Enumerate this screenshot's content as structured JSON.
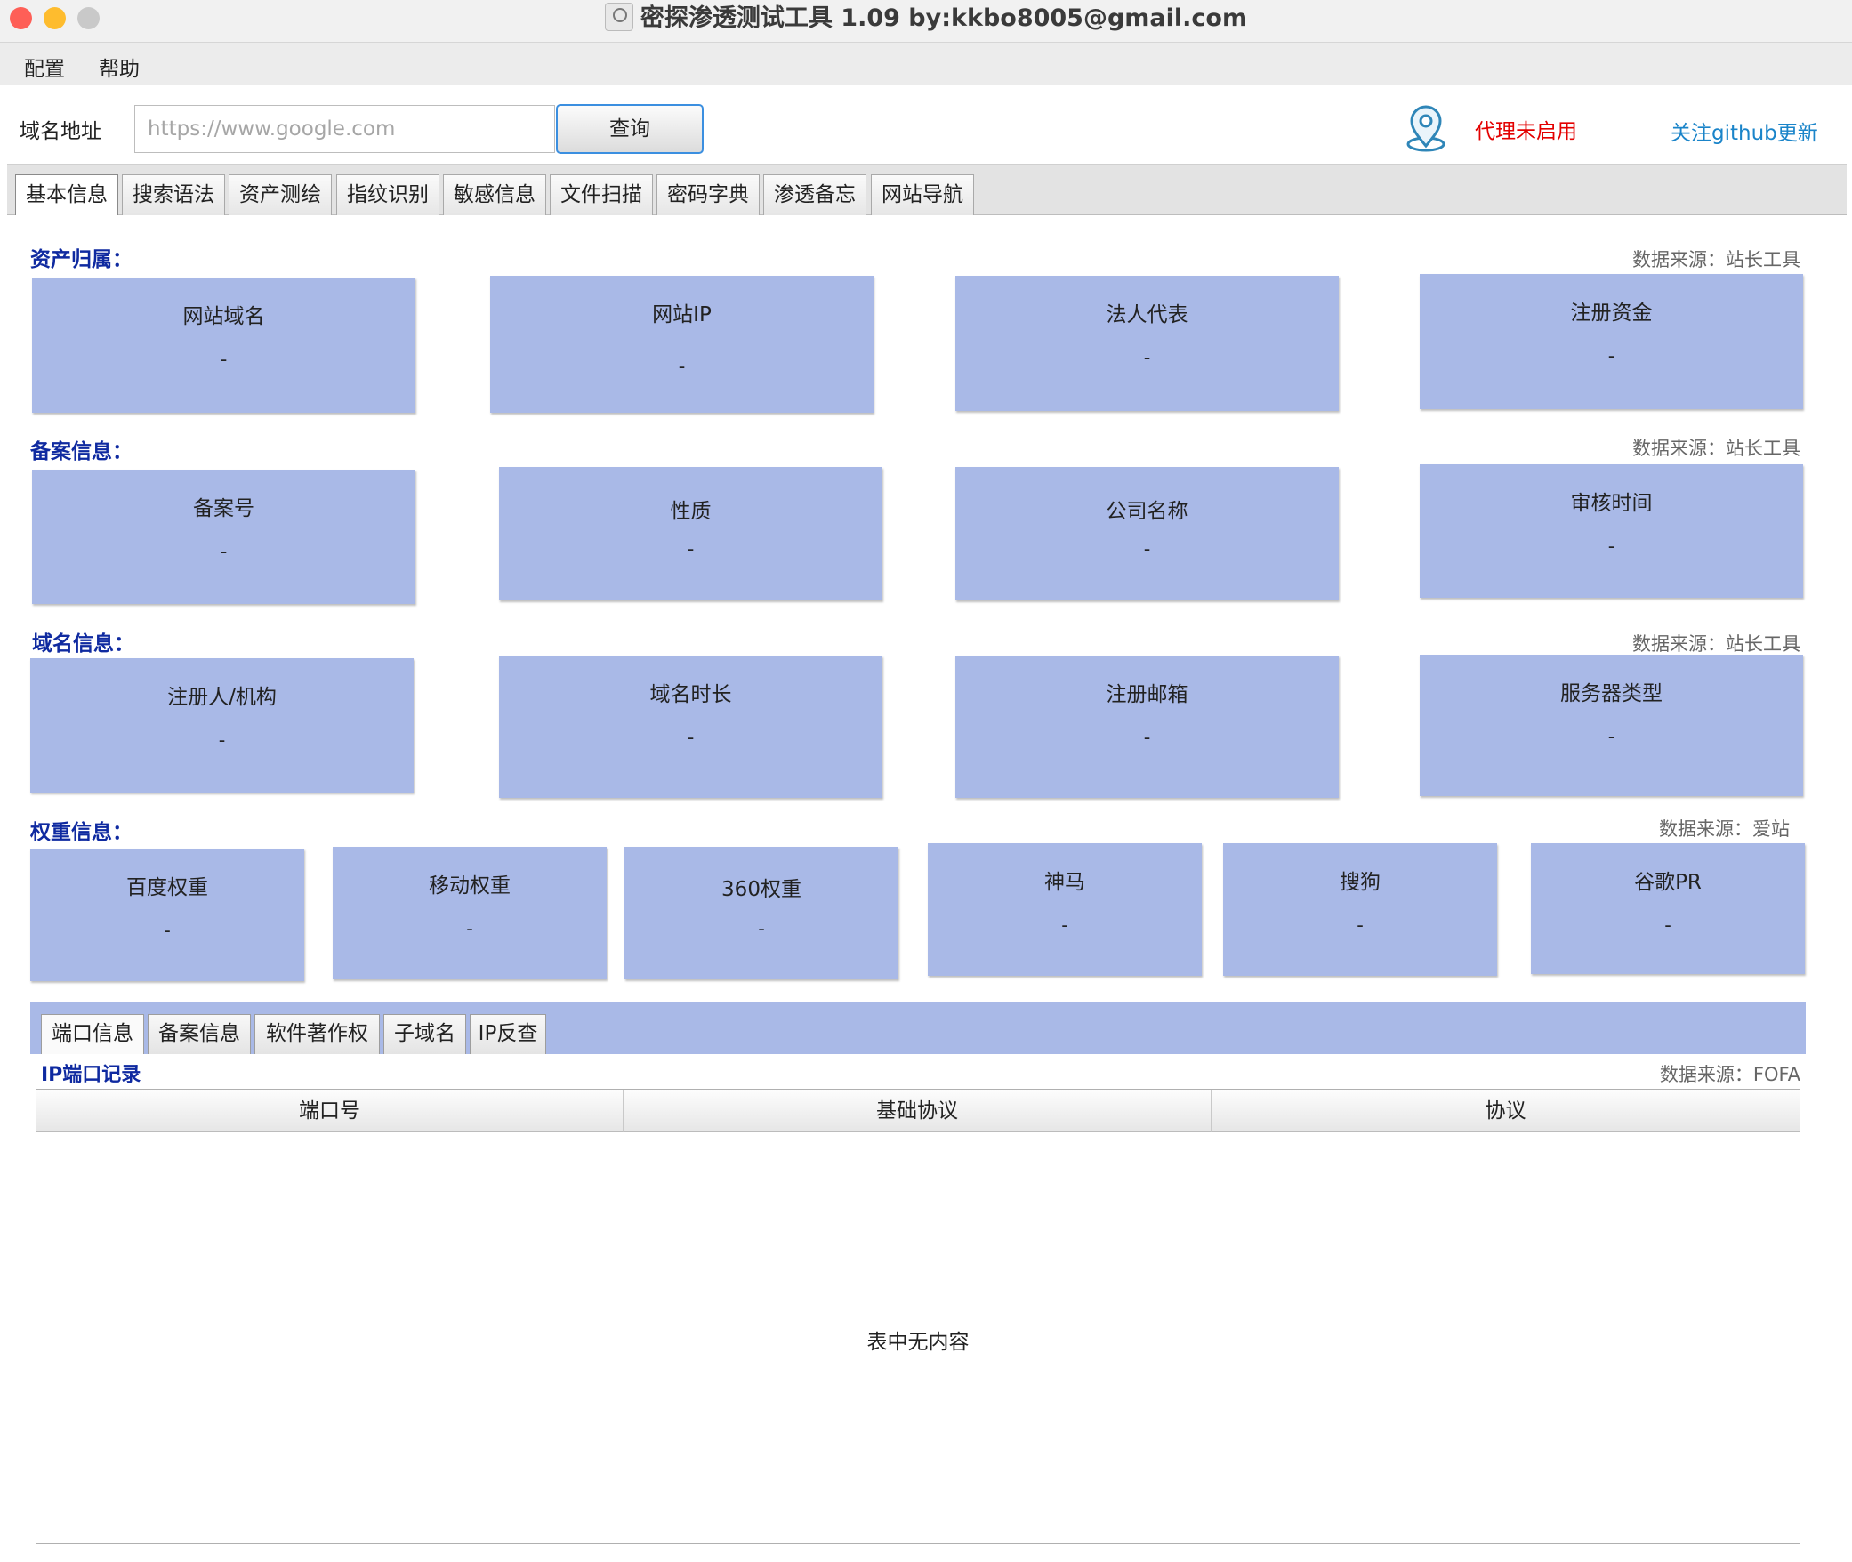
{
  "window": {
    "title": "密探渗透测试工具 1.09 by:kkbo8005@gmail.com",
    "traffic_colors": {
      "close": "#fe5f57",
      "minimize": "#febc2e",
      "zoom": "#c9c9c9"
    }
  },
  "menu": {
    "items": [
      "配置",
      "帮助"
    ]
  },
  "query": {
    "label": "域名地址",
    "placeholder": "https://www.google.com",
    "button": "查询",
    "proxy_icon": "location-pin-icon",
    "proxy_status": "代理未启用",
    "github_link": "关注github更新"
  },
  "tabs": [
    "基本信息",
    "搜索语法",
    "资产测绘",
    "指纹识别",
    "敏感信息",
    "文件扫描",
    "密码字典",
    "渗透备忘",
    "网站导航"
  ],
  "active_tab": "基本信息",
  "sections": [
    {
      "title": "资产归属：",
      "source": "数据来源：站长工具",
      "cards": [
        {
          "label": "网站域名",
          "value": "-"
        },
        {
          "label": "网站IP",
          "value": "-"
        },
        {
          "label": "法人代表",
          "value": "-"
        },
        {
          "label": "注册资金",
          "value": "-"
        }
      ]
    },
    {
      "title": "备案信息：",
      "source": "数据来源：站长工具",
      "cards": [
        {
          "label": "备案号",
          "value": "-"
        },
        {
          "label": "性质",
          "value": "-"
        },
        {
          "label": "公司名称",
          "value": "-"
        },
        {
          "label": "审核时间",
          "value": "-"
        }
      ]
    },
    {
      "title": "域名信息：",
      "source": "数据来源：站长工具",
      "cards": [
        {
          "label": "注册人/机构",
          "value": "-"
        },
        {
          "label": "域名时长",
          "value": "-"
        },
        {
          "label": "注册邮箱",
          "value": "-"
        },
        {
          "label": "服务器类型",
          "value": "-"
        }
      ]
    },
    {
      "title": "权重信息：",
      "source": "数据来源：爱站",
      "cards": [
        {
          "label": "百度权重",
          "value": "-"
        },
        {
          "label": "移动权重",
          "value": "-"
        },
        {
          "label": "360权重",
          "value": "-"
        },
        {
          "label": "神马",
          "value": "-"
        },
        {
          "label": "搜狗",
          "value": "-"
        },
        {
          "label": "谷歌PR",
          "value": "-"
        }
      ]
    }
  ],
  "bottom": {
    "tabs": [
      "端口信息",
      "备案信息",
      "软件著作权",
      "子域名",
      "IP反查"
    ],
    "active_tab": "端口信息",
    "title": "IP端口记录",
    "source": "数据来源：FOFA",
    "columns": [
      "端口号",
      "基础协议",
      "协议"
    ],
    "rows": [],
    "empty_message": "表中无内容"
  },
  "colors": {
    "card": "#a9b9e7",
    "section_title": "#0f2aa0",
    "proxy_status": "#e30000",
    "link": "#1a84c9"
  }
}
